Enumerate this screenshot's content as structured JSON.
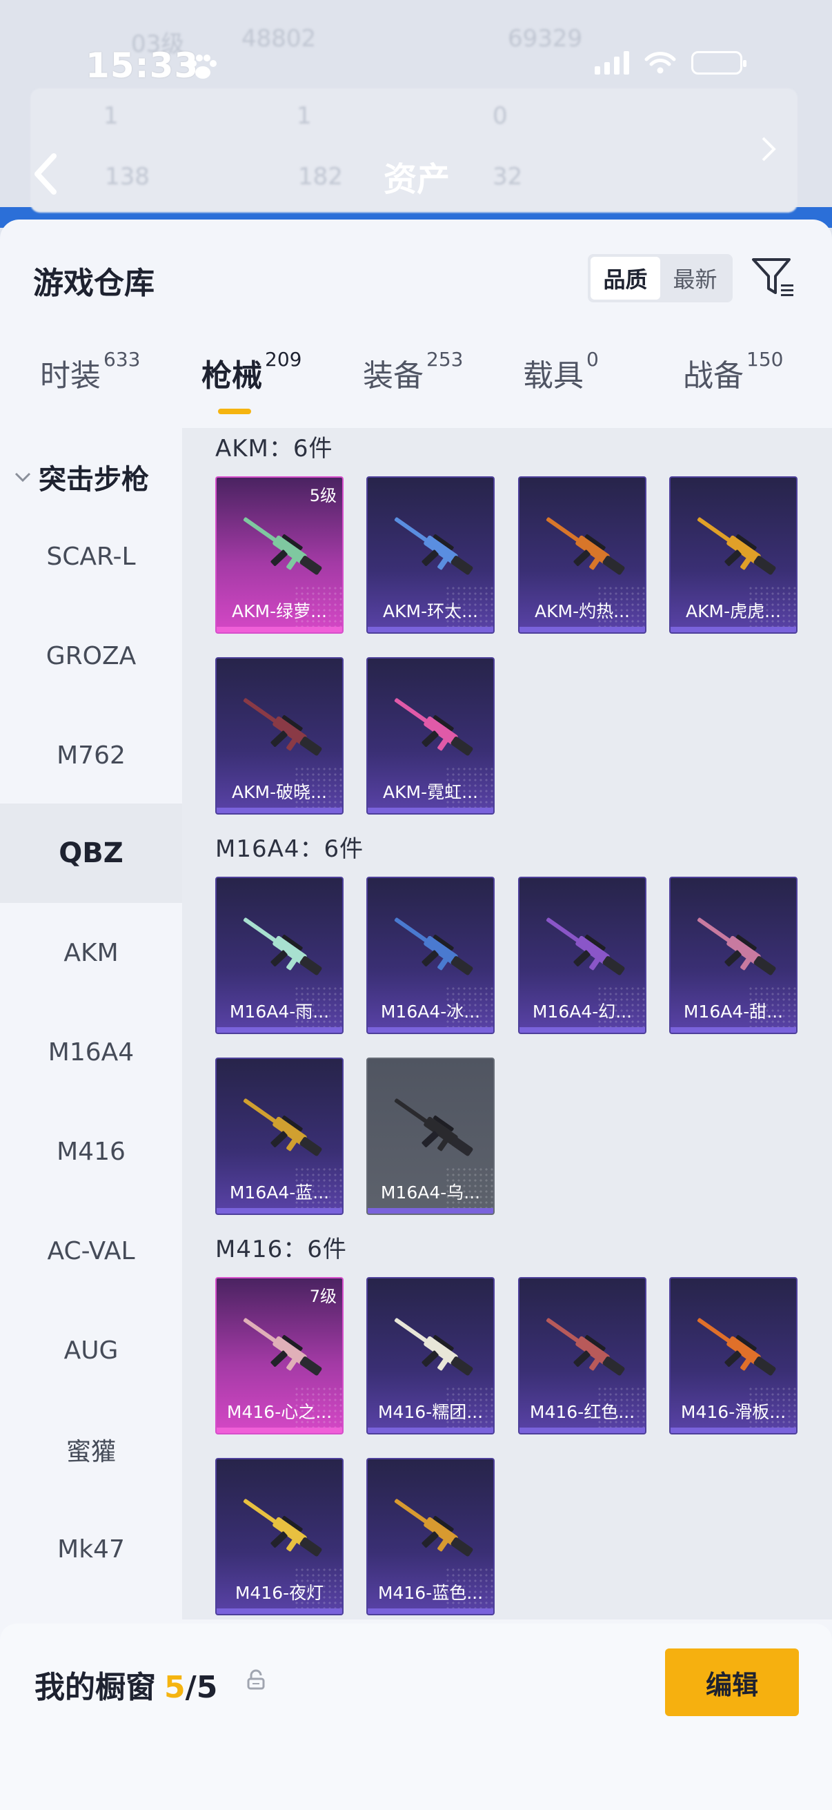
{
  "status_bar": {
    "time": "15:33"
  },
  "background": {
    "title": "资产",
    "faint": [
      "03级",
      "48802",
      "69329",
      "1",
      "1",
      "0",
      "138",
      "182",
      "32"
    ]
  },
  "sheet": {
    "title": "游戏仓库",
    "sort_options": [
      "品质",
      "最新"
    ],
    "active_sort": "品质"
  },
  "tabs": [
    {
      "label": "时装",
      "count": "633"
    },
    {
      "label": "枪械",
      "count": "209"
    },
    {
      "label": "装备",
      "count": "253"
    },
    {
      "label": "载具",
      "count": "0"
    },
    {
      "label": "战备",
      "count": "150"
    }
  ],
  "sidebar": {
    "category": "突击步枪",
    "items": [
      "SCAR-L",
      "GROZA",
      "M762",
      "QBZ",
      "AKM",
      "M16A4",
      "M416",
      "AC-VAL",
      "AUG",
      "蜜獾",
      "Mk47"
    ],
    "active": "QBZ"
  },
  "groups": [
    {
      "title": "AKM：6件",
      "items": [
        {
          "name": "AKM-绿萝...",
          "level": "5级",
          "rarity": "pink",
          "gun_color": "#7fc8a0"
        },
        {
          "name": "AKM-环太...",
          "level": "",
          "rarity": "purple",
          "gun_color": "#5a8ee0"
        },
        {
          "name": "AKM-灼热...",
          "level": "",
          "rarity": "purple",
          "gun_color": "#d8762a"
        },
        {
          "name": "AKM-虎虎...",
          "level": "",
          "rarity": "purple",
          "gun_color": "#e0a028"
        },
        {
          "name": "AKM-破晓...",
          "level": "",
          "rarity": "purple",
          "gun_color": "#8a3a46"
        },
        {
          "name": "AKM-霓虹...",
          "level": "",
          "rarity": "purple",
          "gun_color": "#e05aa8"
        }
      ]
    },
    {
      "title": "M16A4：6件",
      "items": [
        {
          "name": "M16A4-雨...",
          "level": "",
          "rarity": "purple",
          "gun_color": "#a8e0d0"
        },
        {
          "name": "M16A4-冰...",
          "level": "",
          "rarity": "purple",
          "gun_color": "#4a7ad0"
        },
        {
          "name": "M16A4-幻...",
          "level": "",
          "rarity": "purple",
          "gun_color": "#8a56c8"
        },
        {
          "name": "M16A4-甜...",
          "level": "",
          "rarity": "purple",
          "gun_color": "#c87aa0"
        },
        {
          "name": "M16A4-蓝...",
          "level": "",
          "rarity": "purple",
          "gun_color": "#d0a030"
        },
        {
          "name": "M16A4-乌...",
          "level": "",
          "rarity": "gray",
          "gun_color": "#2a2a2e"
        }
      ]
    },
    {
      "title": "M416：6件",
      "items": [
        {
          "name": "M416-心之...",
          "level": "7级",
          "rarity": "pink",
          "gun_color": "#e0b0b8"
        },
        {
          "name": "M416-糯团...",
          "level": "",
          "rarity": "purple",
          "gun_color": "#e8e6d8"
        },
        {
          "name": "M416-红色...",
          "level": "",
          "rarity": "purple",
          "gun_color": "#b85a5a"
        },
        {
          "name": "M416-滑板...",
          "level": "",
          "rarity": "purple",
          "gun_color": "#e0702a"
        },
        {
          "name": "M416-夜灯",
          "level": "",
          "rarity": "purple",
          "gun_color": "#e8c040"
        },
        {
          "name": "M416-蓝色...",
          "level": "",
          "rarity": "purple",
          "gun_color": "#d89a30"
        }
      ]
    }
  ],
  "showcase": {
    "label": "我的橱窗",
    "current": "5",
    "separator": "/",
    "total": "5",
    "edit_label": "编辑"
  }
}
